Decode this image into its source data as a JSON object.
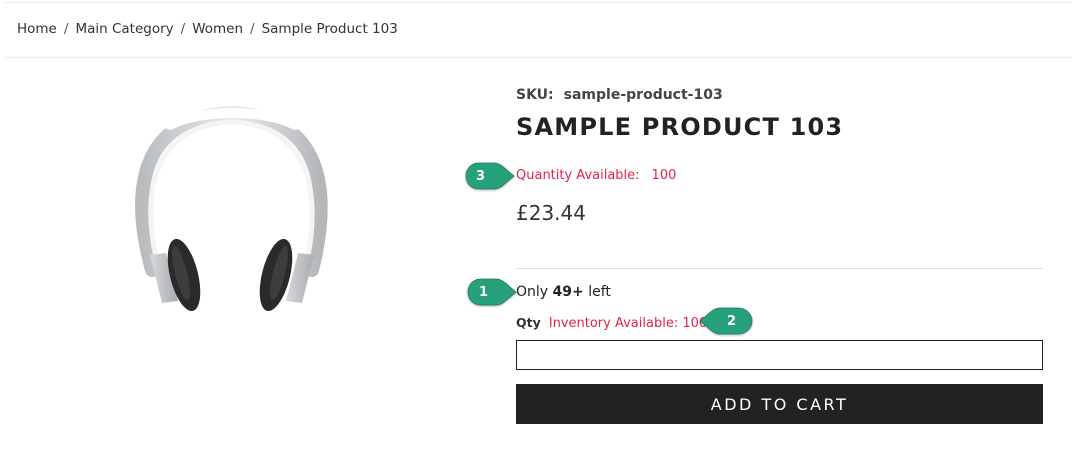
{
  "breadcrumb": {
    "items": [
      "Home",
      "Main Category",
      "Women",
      "Sample Product 103"
    ],
    "separator": "/"
  },
  "product": {
    "image_icon": "headphones-image",
    "sku_label": "SKU:",
    "sku_value": "sample-product-103",
    "title": "SAMPLE PRODUCT 103",
    "quantity_available_label": "Quantity Available:",
    "quantity_available_value": "100",
    "price": "£23.44",
    "stock_prefix": "Only",
    "stock_count": "49+",
    "stock_suffix": "left",
    "qty_label": "Qty",
    "inventory_available": "Inventory Available: 100",
    "qty_value": "",
    "add_to_cart_label": "ADD TO CART"
  },
  "annotations": [
    {
      "number": "1",
      "color": "#27a07c"
    },
    {
      "number": "2",
      "color": "#27a07c"
    },
    {
      "number": "3",
      "color": "#27a07c"
    }
  ],
  "colors": {
    "alert_red": "#e2244a",
    "button_bg": "#222222",
    "callout_green": "#27a07c"
  }
}
